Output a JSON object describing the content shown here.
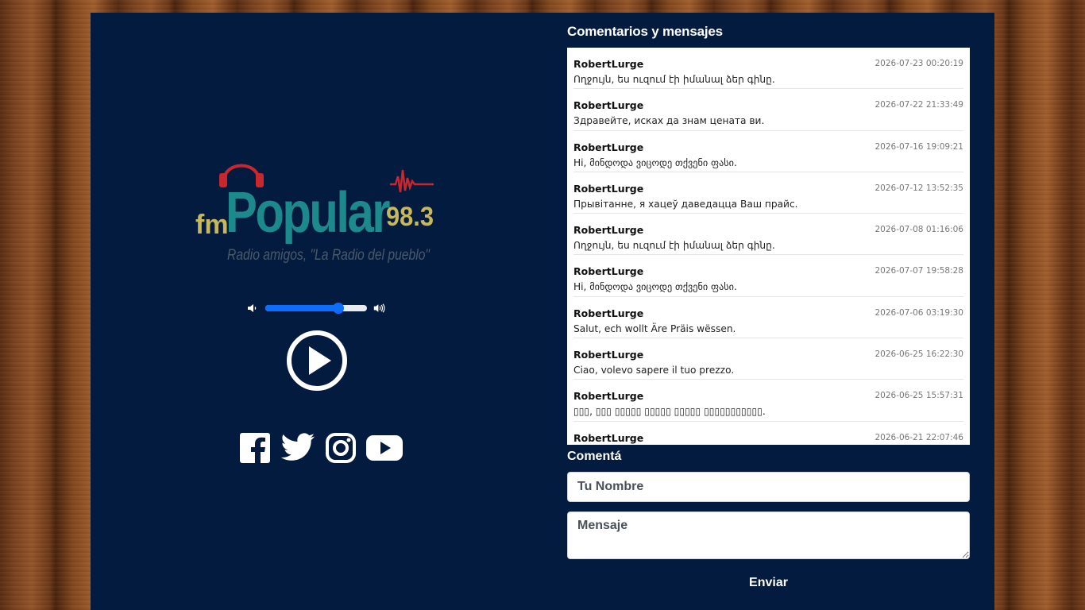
{
  "brand": {
    "prefix": "fm",
    "name": "Popular",
    "frequency": "98.3",
    "tagline": "Radio amigos, \"La Radio del pueblo\""
  },
  "player": {
    "volume_fraction": 0.72,
    "volume_low_icon": "volume-low-icon",
    "volume_high_icon": "volume-high-icon",
    "play_icon": "play-circle-icon"
  },
  "social": [
    {
      "name": "facebook-icon"
    },
    {
      "name": "twitter-icon"
    },
    {
      "name": "instagram-icon"
    },
    {
      "name": "youtube-icon"
    }
  ],
  "comments": {
    "title": "Comentarios y mensajes",
    "items": [
      {
        "author": "RobertLurge",
        "date": "2026-07-23 00:20:19",
        "message": "Ողջույն, ես ուզում էի իմանալ ձեր գինը."
      },
      {
        "author": "RobertLurge",
        "date": "2026-07-22 21:33:49",
        "message": "Здравейте, исках да знам цената ви."
      },
      {
        "author": "RobertLurge",
        "date": "2026-07-16 19:09:21",
        "message": "Hi, მინდოდა ვიცოდე თქვენი ფასი."
      },
      {
        "author": "RobertLurge",
        "date": "2026-07-12 13:52:35",
        "message": "Прывітанне, я хацеў даведацца Ваш прайс."
      },
      {
        "author": "RobertLurge",
        "date": "2026-07-08 01:16:06",
        "message": "Ողջույն, ես ուզում էի իմանալ ձեր գինը."
      },
      {
        "author": "RobertLurge",
        "date": "2026-07-07 19:58:28",
        "message": "Hi, მინდოდა ვიცოდე თქვენი ფასი."
      },
      {
        "author": "RobertLurge",
        "date": "2026-07-06 03:19:30",
        "message": "Salut, ech wollt Äre Präis wëssen."
      },
      {
        "author": "RobertLurge",
        "date": "2026-06-25 16:22:30",
        "message": "Ciao, volevo sapere il tuo prezzo."
      },
      {
        "author": "RobertLurge",
        "date": "2026-06-25 15:57:31",
        "message": "▯▯▯, ▯▯▯ ▯▯▯▯▯ ▯▯▯▯▯ ▯▯▯▯▯ ▯▯▯▯▯▯▯▯▯▯▯."
      },
      {
        "author": "RobertLurge",
        "date": "2026-06-21 22:07:46",
        "message": ""
      }
    ]
  },
  "form": {
    "title": "Comentá",
    "name_placeholder": "Tu Nombre",
    "message_placeholder": "Mensaje",
    "send_label": "Enviar"
  }
}
